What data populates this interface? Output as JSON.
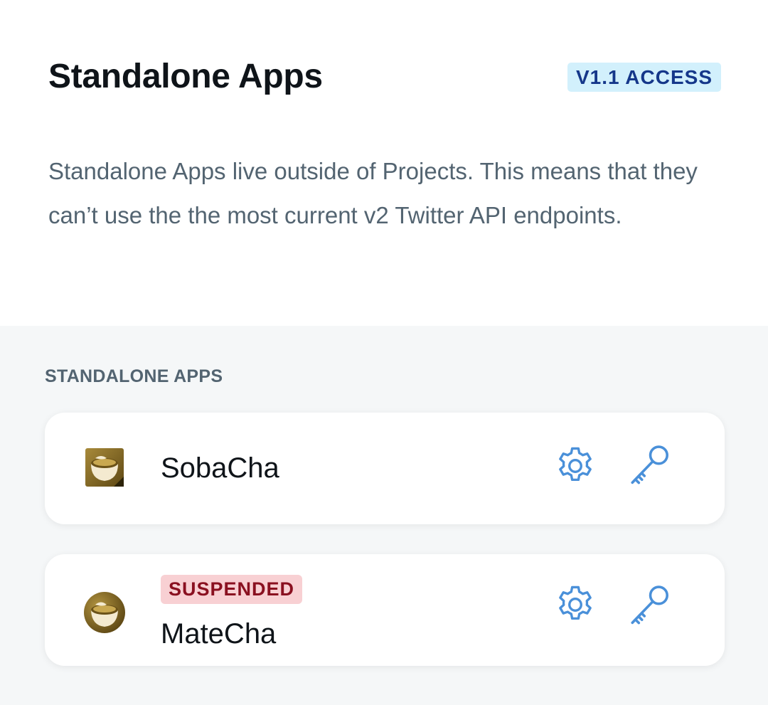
{
  "header": {
    "title": "Standalone Apps",
    "access_badge": "V1.1 ACCESS",
    "description": "Standalone Apps live outside of Projects. This means that they can’t use the the most current v2 Twitter API endpoints."
  },
  "apps_section": {
    "label": "STANDALONE APPS",
    "apps": [
      {
        "name": "SobaCha",
        "status_badge": "",
        "logo_icon": "tea-cup-app-logo-square",
        "settings_icon": "gear-icon",
        "keys_icon": "key-icon"
      },
      {
        "name": "MateCha",
        "status_badge": "SUSPENDED",
        "logo_icon": "tea-cup-app-logo-round",
        "settings_icon": "gear-icon",
        "keys_icon": "key-icon"
      }
    ]
  },
  "colors": {
    "accent_icon": "#4a90d9",
    "access_badge_bg": "#d2f0fc",
    "access_badge_text": "#15378a",
    "suspended_bg": "#f8d0d3",
    "suspended_text": "#8a1020",
    "section_bg": "#f5f7f8"
  }
}
